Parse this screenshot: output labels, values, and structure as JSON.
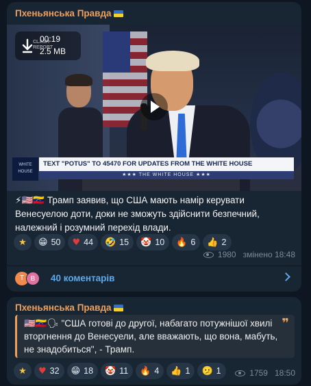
{
  "post1": {
    "channel": "Пхеньянська Правда",
    "video": {
      "duration": "00:19",
      "size": "2.5 MB",
      "watermark_line1": "CLASH",
      "watermark_line2": "REPORT",
      "chyron": "TEXT \"POTUS\" TO 45470 FOR UPDATES FROM THE WHITE HOUSE",
      "chyron_sub": "★★★ THE WHITE HOUSE ★★★",
      "chyron_logo": "WHITE HOUSE"
    },
    "text": "⚡🇺🇸🇻🇪 Трамп заявив, що США мають намір керувати Венесуелою доти, доки не зможуть здійснити безпечний, належний і розумний перехід влади.",
    "reactions": [
      {
        "emoji": "★",
        "count": ""
      },
      {
        "emoji": "😁",
        "count": "50"
      },
      {
        "emoji": "♥",
        "count": "44"
      },
      {
        "emoji": "🤣",
        "count": "15"
      },
      {
        "emoji": "🤡",
        "count": "10"
      },
      {
        "emoji": "🔥",
        "count": "6"
      },
      {
        "emoji": "👍",
        "count": "2"
      }
    ],
    "views": "1980",
    "edited_time": "змінено 18:48",
    "comments": {
      "avatar1": "Т",
      "avatar2": "В",
      "label": "40 коментарів"
    }
  },
  "post2": {
    "channel": "Пхеньянська Правда",
    "quote": "🇺🇸🇻🇪🗣 \"США готові до другої, набагато потужнішої хвилі вторгнення до Венесуели, але вважають, що вона, мабуть, не знадобиться\", -  Трамп.",
    "reactions": [
      {
        "emoji": "★",
        "count": ""
      },
      {
        "emoji": "♥",
        "count": "32"
      },
      {
        "emoji": "😁",
        "count": "18"
      },
      {
        "emoji": "🤡",
        "count": "11"
      },
      {
        "emoji": "🔥",
        "count": "4"
      },
      {
        "emoji": "👍",
        "count": "1"
      },
      {
        "emoji": "🫤",
        "count": "1"
      }
    ],
    "views": "1759",
    "time": "18:50"
  },
  "colors": {
    "background": "#0e1621",
    "bubble": "#182533",
    "channel_name": "#f0a05a",
    "link": "#5fa9e8",
    "meta": "#7d8b99"
  }
}
